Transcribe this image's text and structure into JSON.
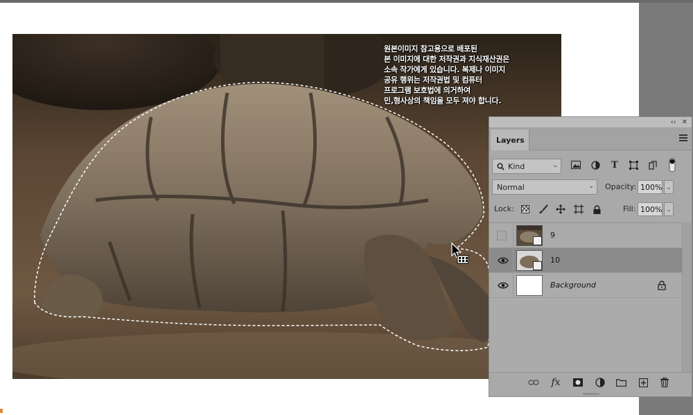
{
  "watermark": {
    "text": "원본이미지 참고용으로 배포된\n본 이미지에 대한 저작권과 지식재산권은\n소속 작가에게 있습니다. 복제나 이미지\n공유 행위는 저작권법 및 컴퓨터\n프로그램 보호법에 의거하여\n민,형사상의 책임을 모두 져야 합니다."
  },
  "panel": {
    "collapse_label": "‹‹",
    "close_label": "✕",
    "tab_label": "Layers",
    "filter": {
      "kind_label": "Kind"
    },
    "blend": {
      "mode": "Normal",
      "opacity_label": "Opacity:",
      "opacity_value": "100%"
    },
    "lock": {
      "label": "Lock:",
      "fill_label": "Fill:",
      "fill_value": "100%"
    },
    "layers": [
      {
        "name": "9",
        "visible": false,
        "selected": false,
        "smart_object": true
      },
      {
        "name": "10",
        "visible": true,
        "selected": true,
        "smart_object": true
      },
      {
        "name": "Background",
        "visible": true,
        "selected": false,
        "locked": true
      }
    ]
  },
  "colors": {
    "panel_bg": "#a9a9a9",
    "selected_row": "#8b8b8b",
    "workspace_gray": "#7a7a7a"
  }
}
